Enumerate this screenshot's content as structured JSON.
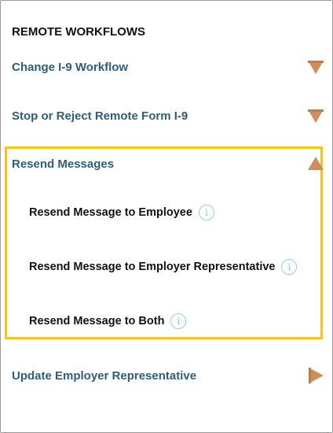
{
  "panel": {
    "title": "REMOTE WORKFLOWS"
  },
  "menu": {
    "change_i9": {
      "label": "Change I-9 Workflow",
      "state": "collapsed"
    },
    "stop_reject": {
      "label": "Stop or Reject Remote Form I-9",
      "state": "collapsed"
    },
    "resend": {
      "label": "Resend Messages",
      "state": "expanded"
    },
    "update_rep": {
      "label": "Update Employer Representative",
      "state": "link"
    }
  },
  "resend_items": {
    "employee": "Resend Message to Employee",
    "employer_rep": "Resend Message to Employer Representative",
    "both": "Resend Message to Both"
  },
  "icons": {
    "info": "i",
    "arrow_down": "triangle-down",
    "arrow_up": "triangle-up",
    "arrow_right": "triangle-right"
  },
  "colors": {
    "link_blue": "#2f5d7c",
    "arrow_orange": "#d08c5a",
    "highlight_yellow": "#f5c518",
    "info_blue": "#8fd0ea"
  }
}
